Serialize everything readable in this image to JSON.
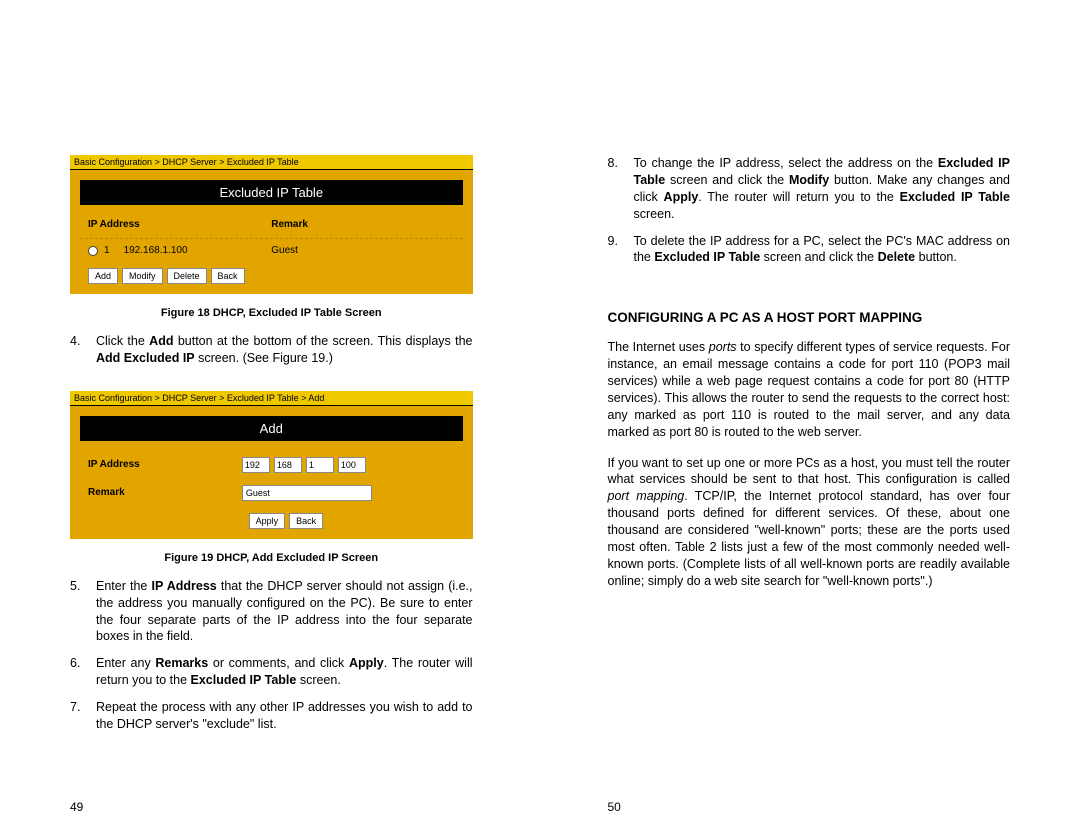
{
  "left": {
    "fig18": {
      "breadcrumb": "Basic Configuration > DHCP Server > Excluded IP Table",
      "title": "Excluded IP Table",
      "headers": {
        "ip": "IP Address",
        "remark": "Remark"
      },
      "row": {
        "idx": "1",
        "ip": "192.168.1.100",
        "remark": "Guest"
      },
      "buttons": {
        "add": "Add",
        "modify": "Modify",
        "delete": "Delete",
        "back": "Back"
      },
      "caption": "Figure 18    DHCP, Excluded IP Table Screen"
    },
    "step4": {
      "num": "4.",
      "text_a": "Click  the  ",
      "bold1": "Add",
      "text_b": "  button  at  the  bottom  of  the  screen.    This displays the ",
      "bold2": "Add Excluded IP",
      "text_c": " screen.   (See Figure 19.)"
    },
    "fig19": {
      "breadcrumb": "Basic Configuration > DHCP Server > Excluded IP Table > Add",
      "title": "Add",
      "labels": {
        "ip": "IP Address",
        "remark": "Remark"
      },
      "ip": {
        "o1": "192",
        "o2": "168",
        "o3": "1",
        "o4": "100"
      },
      "remark": "Guest",
      "buttons": {
        "apply": "Apply",
        "back": "Back"
      },
      "caption": "Figure 19    DHCP, Add Excluded IP Screen"
    },
    "step5": {
      "num": "5.",
      "text_a": "Enter  the  ",
      "bold1": "IP  Address",
      "text_b": "  that  the  DHCP  server  should  not assign (i.e., the address you manually configured on the PC).  Be sure to enter the four separate parts of the IP address into the four separate boxes in the field."
    },
    "step6": {
      "num": "6.",
      "text_a": "Enter  any  ",
      "bold1": "Remarks",
      "text_b": "  or  comments,  and  click  ",
      "bold2": "Apply",
      "text_c": ".    The router will return you to the ",
      "bold3": "Excluded IP Table",
      "text_d": " screen."
    },
    "step7": {
      "num": "7.",
      "text": "Repeat the process with any other IP addresses you wish to add to the DHCP server's \"exclude\" list."
    },
    "page_number": "49"
  },
  "right": {
    "step8": {
      "num": "8.",
      "text_a": "To  change  the  IP  address,  select  the  address  on  the ",
      "bold1": "Excluded  IP  Table",
      "text_b": "  screen  and  click  the  ",
      "bold2": "Modify",
      "text_c": "  button.  Make any changes and click ",
      "bold3": "Apply",
      "text_d": ".   The router will return you to the ",
      "bold4": "Excluded IP Table",
      "text_e": " screen."
    },
    "step9": {
      "num": "9.",
      "text_a": "To  delete  the  IP  address  for  a  PC,  select  the  PC's  MAC address  on  the  ",
      "bold1": "Excluded  IP  Table",
      "text_b": "  screen  and  click  the ",
      "bold2": "Delete",
      "text_c": " button."
    },
    "heading": "CONFIGURING A PC AS A HOST PORT MAPPING",
    "para1_a": "The  Internet  uses  ",
    "para1_ital": "ports",
    "para1_b": "  to  specify  different  types  of  service requests.    For instance, an email message contains a code for port  110  (POP3  mail  services)  while  a  web  page  request contains  a  code  for  port  80  (HTTP  services).    This  allows  the router to send the requests to the correct host: any marked as port 110 is routed to the mail server, and any data marked as port 80 is routed to the web server.",
    "para2_a": "If you want to set up one or more PCs as a host, you must tell the router   what   services   should   be   sent   to   that   host.      This configuration  is  called  ",
    "para2_ital": "port  mapping",
    "para2_b": ".      TCP/IP,  the  Internet protocol  standard,  has  over  four  thousand  ports  defined  for different    services.        Of    these,    about    one    thousand    are considered  \"well-known\"  ports;  these  are  the  ports  used  most often.    Table  2  lists  just  a  few  of  the  most  commonly  needed well-known  ports.    (Complete  lists  of  all  well-known  ports  are readily   available   online;   simply   do   a   web   site   search   for \"well-known ports\".)",
    "page_number": "50"
  }
}
